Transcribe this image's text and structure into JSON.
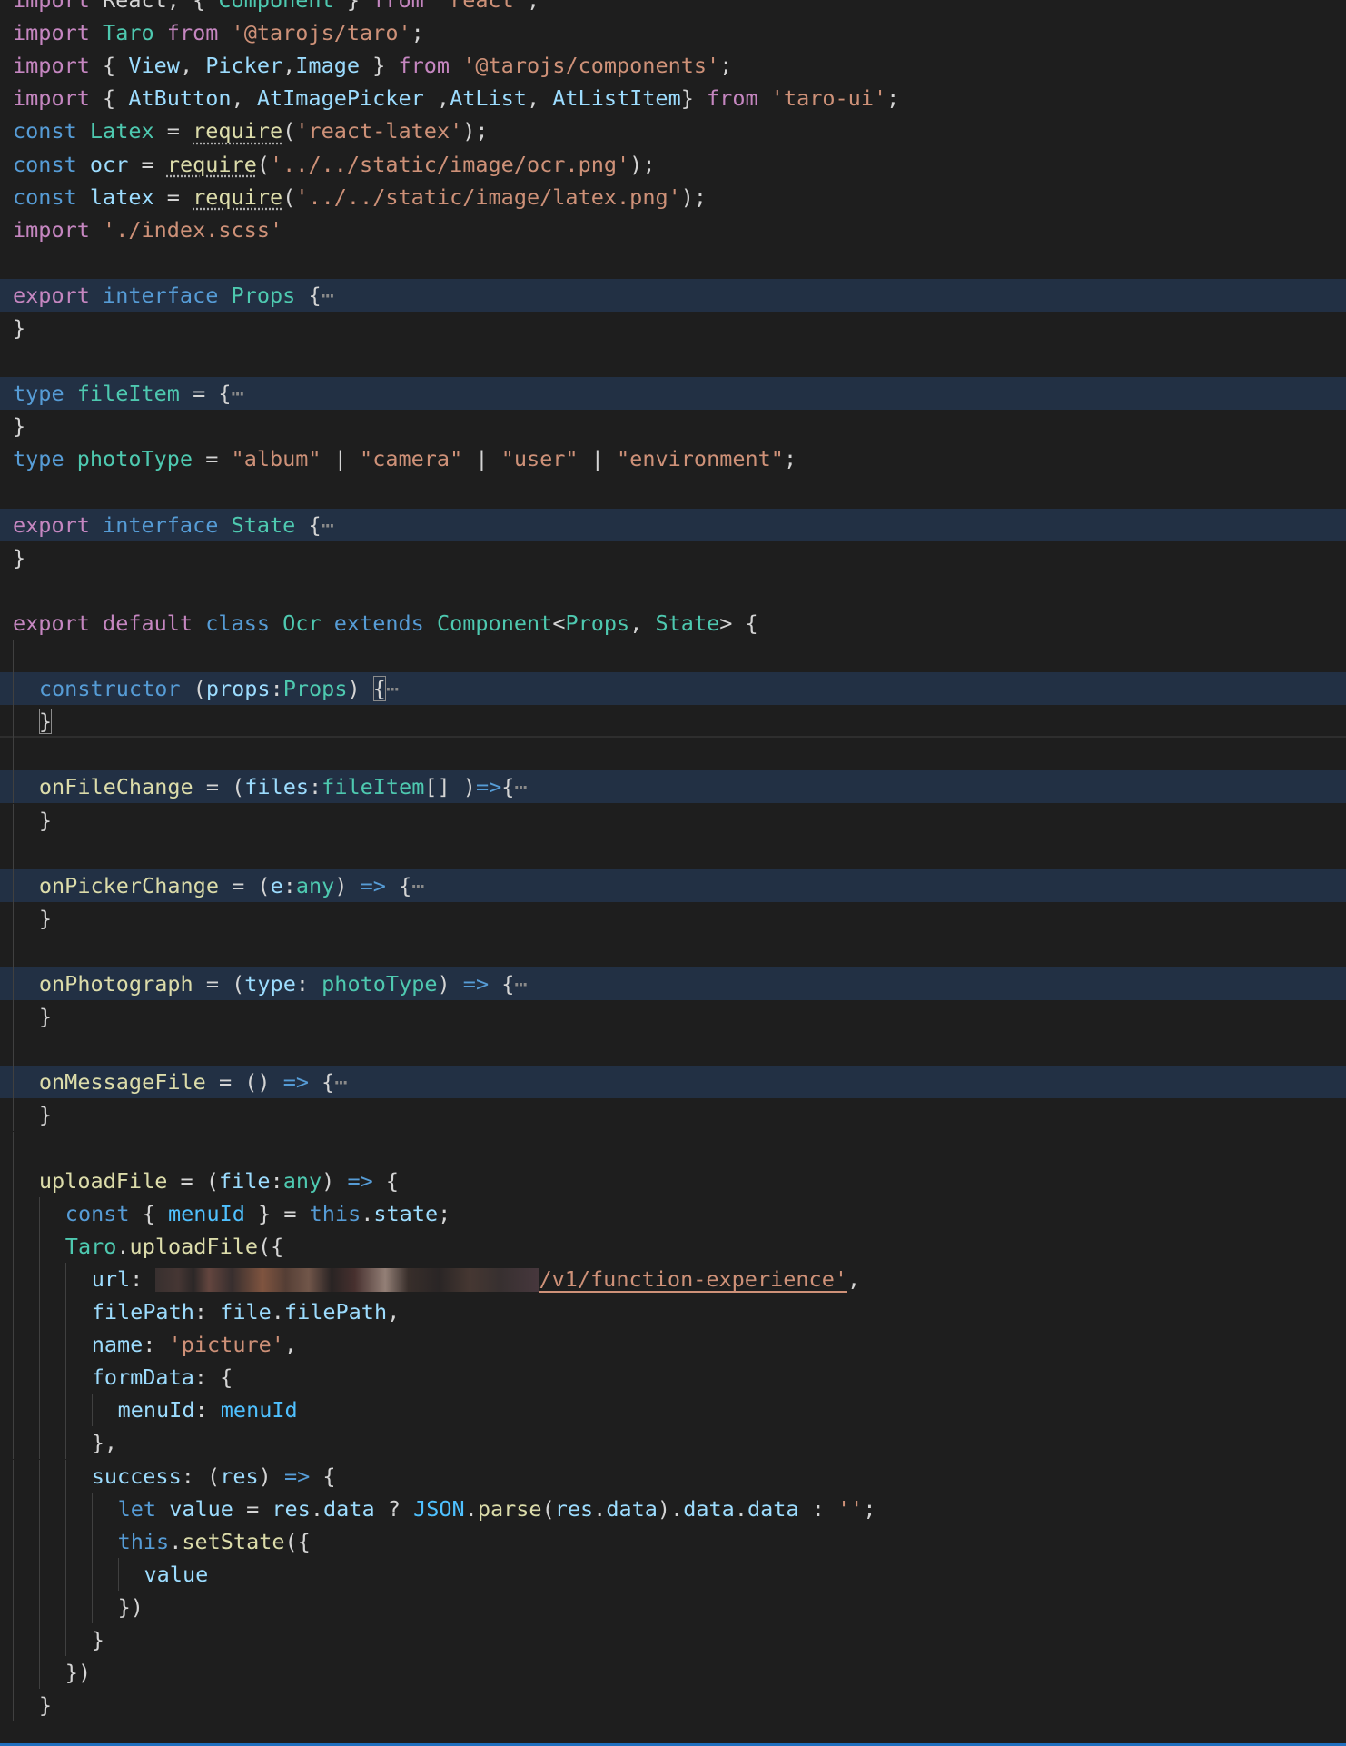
{
  "editor": {
    "file_language": "TypeScript React",
    "lines": [
      {
        "id": "l0",
        "tokens": [
          {
            "t": "import React, { Component } from 'react';"
          }
        ]
      },
      {
        "id": "l1",
        "tokens": [
          {
            "t": "import Taro from '@tarojs/taro';"
          }
        ]
      },
      {
        "id": "l2",
        "tokens": [
          {
            "t": "import { View, Picker,Image } from '@tarojs/components';"
          }
        ]
      },
      {
        "id": "l3",
        "tokens": [
          {
            "t": "import { AtButton, AtImagePicker ,AtList, AtListItem} from 'taro-ui';"
          }
        ]
      },
      {
        "id": "l4",
        "tokens": [
          {
            "t": "const Latex = require('react-latex');"
          }
        ]
      },
      {
        "id": "l5",
        "tokens": [
          {
            "t": "const ocr = require('../../static/image/ocr.png');"
          }
        ]
      },
      {
        "id": "l6",
        "tokens": [
          {
            "t": "const latex = require('../../static/image/latex.png');"
          }
        ]
      },
      {
        "id": "l7",
        "tokens": [
          {
            "t": "import './index.scss'"
          }
        ]
      },
      {
        "id": "l9",
        "tokens": [
          {
            "t": "export interface Props {"
          }
        ]
      },
      {
        "id": "l10",
        "tokens": [
          {
            "t": "}"
          }
        ]
      },
      {
        "id": "l12",
        "tokens": [
          {
            "t": "type fileItem = {"
          }
        ]
      },
      {
        "id": "l13",
        "tokens": [
          {
            "t": "}"
          }
        ]
      },
      {
        "id": "l14",
        "tokens": [
          {
            "t": "type photoType = \"album\" | \"camera\" | \"user\" | \"environment\";"
          }
        ]
      },
      {
        "id": "l16",
        "tokens": [
          {
            "t": "export interface State {"
          }
        ]
      },
      {
        "id": "l17",
        "tokens": [
          {
            "t": "}"
          }
        ]
      },
      {
        "id": "l19",
        "tokens": [
          {
            "t": "export default class Ocr extends Component<Props, State> {"
          }
        ]
      },
      {
        "id": "l21",
        "tokens": [
          {
            "t": "constructor (props:Props) {"
          }
        ]
      },
      {
        "id": "l22",
        "tokens": [
          {
            "t": "}"
          }
        ]
      },
      {
        "id": "l24",
        "tokens": [
          {
            "t": "onFileChange = (files:fileItem[] )=>{"
          }
        ]
      },
      {
        "id": "l25",
        "tokens": [
          {
            "t": "}"
          }
        ]
      },
      {
        "id": "l27",
        "tokens": [
          {
            "t": "onPickerChange = (e:any) => {"
          }
        ]
      },
      {
        "id": "l28",
        "tokens": [
          {
            "t": "}"
          }
        ]
      },
      {
        "id": "l30",
        "tokens": [
          {
            "t": "onPhotograph = (type: photoType) => {"
          }
        ]
      },
      {
        "id": "l31",
        "tokens": [
          {
            "t": "}"
          }
        ]
      },
      {
        "id": "l33",
        "tokens": [
          {
            "t": "onMessageFile = () => {"
          }
        ]
      },
      {
        "id": "l34",
        "tokens": [
          {
            "t": "}"
          }
        ]
      },
      {
        "id": "l36",
        "tokens": [
          {
            "t": "uploadFile = (file:any) => {"
          }
        ]
      },
      {
        "id": "l37",
        "tokens": [
          {
            "t": "const { menuId } = this.state;"
          }
        ]
      },
      {
        "id": "l38",
        "tokens": [
          {
            "t": "Taro.uploadFile({"
          }
        ]
      },
      {
        "id": "l39",
        "tokens": [
          {
            "t": "url: '/v1/function-experience',"
          }
        ]
      },
      {
        "id": "l40",
        "tokens": [
          {
            "t": "filePath: file.filePath,"
          }
        ]
      },
      {
        "id": "l41",
        "tokens": [
          {
            "t": "name: 'picture',"
          }
        ]
      },
      {
        "id": "l42",
        "tokens": [
          {
            "t": "formData: {"
          }
        ]
      },
      {
        "id": "l43",
        "tokens": [
          {
            "t": "menuId: menuId"
          }
        ]
      },
      {
        "id": "l44",
        "tokens": [
          {
            "t": "},"
          }
        ]
      },
      {
        "id": "l45",
        "tokens": [
          {
            "t": "success: (res) => {"
          }
        ]
      },
      {
        "id": "l46",
        "tokens": [
          {
            "t": "let value = res.data ? JSON.parse(res.data).data.data : '';"
          }
        ]
      },
      {
        "id": "l47",
        "tokens": [
          {
            "t": "this.setState({"
          }
        ]
      },
      {
        "id": "l48",
        "tokens": [
          {
            "t": "value"
          }
        ]
      },
      {
        "id": "l49",
        "tokens": [
          {
            "t": "})"
          }
        ]
      },
      {
        "id": "l50",
        "tokens": [
          {
            "t": "}"
          }
        ]
      },
      {
        "id": "l51",
        "tokens": [
          {
            "t": "})"
          }
        ]
      },
      {
        "id": "l52",
        "tokens": [
          {
            "t": "}"
          }
        ]
      }
    ],
    "fold_marker": "⋯",
    "colors": {
      "background": "#1e1e1e",
      "folded_line": "#223044",
      "keyword": "#c586c0",
      "storage": "#569cd6",
      "type": "#4ec9b0",
      "function": "#dcdcaa",
      "variable": "#9cdcfe",
      "string": "#ce9178",
      "plain": "#d4d4d4"
    }
  },
  "spans": {
    "l0": [
      "import",
      " React, { ",
      "Component",
      " } ",
      "from",
      " ",
      "'react'",
      ";"
    ],
    "l1": [
      "import",
      " ",
      "Taro",
      " ",
      "from",
      " ",
      "'@tarojs/taro'",
      ";"
    ],
    "l2": [
      "import",
      " { ",
      "View",
      ", ",
      "Picker",
      ",",
      "Image",
      " } ",
      "from",
      " ",
      "'@tarojs/components'",
      ";"
    ],
    "l3": [
      "import",
      " { ",
      "AtButton",
      ", ",
      "AtImagePicker",
      " ,",
      "AtList",
      ", ",
      "AtListItem",
      "} ",
      "from",
      " ",
      "'taro-ui'",
      ";"
    ],
    "l4": [
      "const",
      " ",
      "Latex",
      " = ",
      "require",
      "(",
      "'react-latex'",
      ");"
    ],
    "l5": [
      "const",
      " ",
      "ocr",
      " = ",
      "require",
      "(",
      "'../../static/image/ocr.png'",
      ");"
    ],
    "l6": [
      "const",
      " ",
      "latex",
      " = ",
      "require",
      "(",
      "'../../static/image/latex.png'",
      ");"
    ],
    "l7": [
      "import",
      " ",
      "'./index.scss'"
    ],
    "l9": [
      "export",
      " ",
      "interface",
      " ",
      "Props",
      " {",
      "⋯"
    ],
    "l10": [
      "}"
    ],
    "l12": [
      "type",
      " ",
      "fileItem",
      " = {",
      "⋯"
    ],
    "l13": [
      "}"
    ],
    "l14": [
      "type",
      " ",
      "photoType",
      " = ",
      "\"album\"",
      " | ",
      "\"camera\"",
      " | ",
      "\"user\"",
      " | ",
      "\"environment\"",
      ";"
    ],
    "l16": [
      "export",
      " ",
      "interface",
      " ",
      "State",
      " {",
      "⋯"
    ],
    "l17": [
      "}"
    ],
    "l19": [
      "export",
      " ",
      "default",
      " ",
      "class",
      " ",
      "Ocr",
      " ",
      "extends",
      " ",
      "Component",
      "<",
      "Props",
      ", ",
      "State",
      "> {"
    ],
    "l21": [
      "constructor",
      " (",
      "props",
      ":",
      "Props",
      ") ",
      "{",
      "⋯"
    ],
    "l22": [
      "}"
    ],
    "l24": [
      "onFileChange",
      " = (",
      "files",
      ":",
      "fileItem",
      "[] )",
      "=>",
      "{",
      "⋯"
    ],
    "l25": [
      "}"
    ],
    "l27": [
      "onPickerChange",
      " = (",
      "e",
      ":",
      "any",
      ") ",
      "=>",
      " {",
      "⋯"
    ],
    "l28": [
      "}"
    ],
    "l30": [
      "onPhotograph",
      " = (",
      "type",
      ": ",
      "photoType",
      ") ",
      "=>",
      " {",
      "⋯"
    ],
    "l31": [
      "}"
    ],
    "l33": [
      "onMessageFile",
      " = () ",
      "=>",
      " {",
      "⋯"
    ],
    "l34": [
      "}"
    ],
    "l36": [
      "uploadFile",
      " = (",
      "file",
      ":",
      "any",
      ") ",
      "=>",
      " {"
    ],
    "l37": [
      "const",
      " { ",
      "menuId",
      " } = ",
      "this",
      ".",
      "state",
      ";"
    ],
    "l38": [
      "Taro",
      ".",
      "uploadFile",
      "({"
    ],
    "l39": [
      "url",
      ": ",
      "",
      "/v1/function-experience'",
      ","
    ],
    "l40": [
      "filePath",
      ": ",
      "file",
      ".",
      "filePath",
      ","
    ],
    "l41": [
      "name",
      ": ",
      "'picture'",
      ","
    ],
    "l42": [
      "formData",
      ": {"
    ],
    "l43": [
      "menuId",
      ": ",
      "menuId"
    ],
    "l44": [
      "},"
    ],
    "l45": [
      "success",
      ": (",
      "res",
      ") ",
      "=>",
      " {"
    ],
    "l46": [
      "let",
      " ",
      "value",
      " = ",
      "res",
      ".",
      "data",
      " ? ",
      "JSON",
      ".",
      "parse",
      "(",
      "res",
      ".",
      "data",
      ").",
      "data",
      ".",
      "data",
      " : ",
      "''",
      ";"
    ],
    "l47": [
      "this",
      ".",
      "setState",
      "({"
    ],
    "l48": [
      "value"
    ],
    "l49": [
      "})"
    ],
    "l50": [
      "}"
    ],
    "l51": [
      "})"
    ],
    "l52": [
      "}"
    ]
  }
}
